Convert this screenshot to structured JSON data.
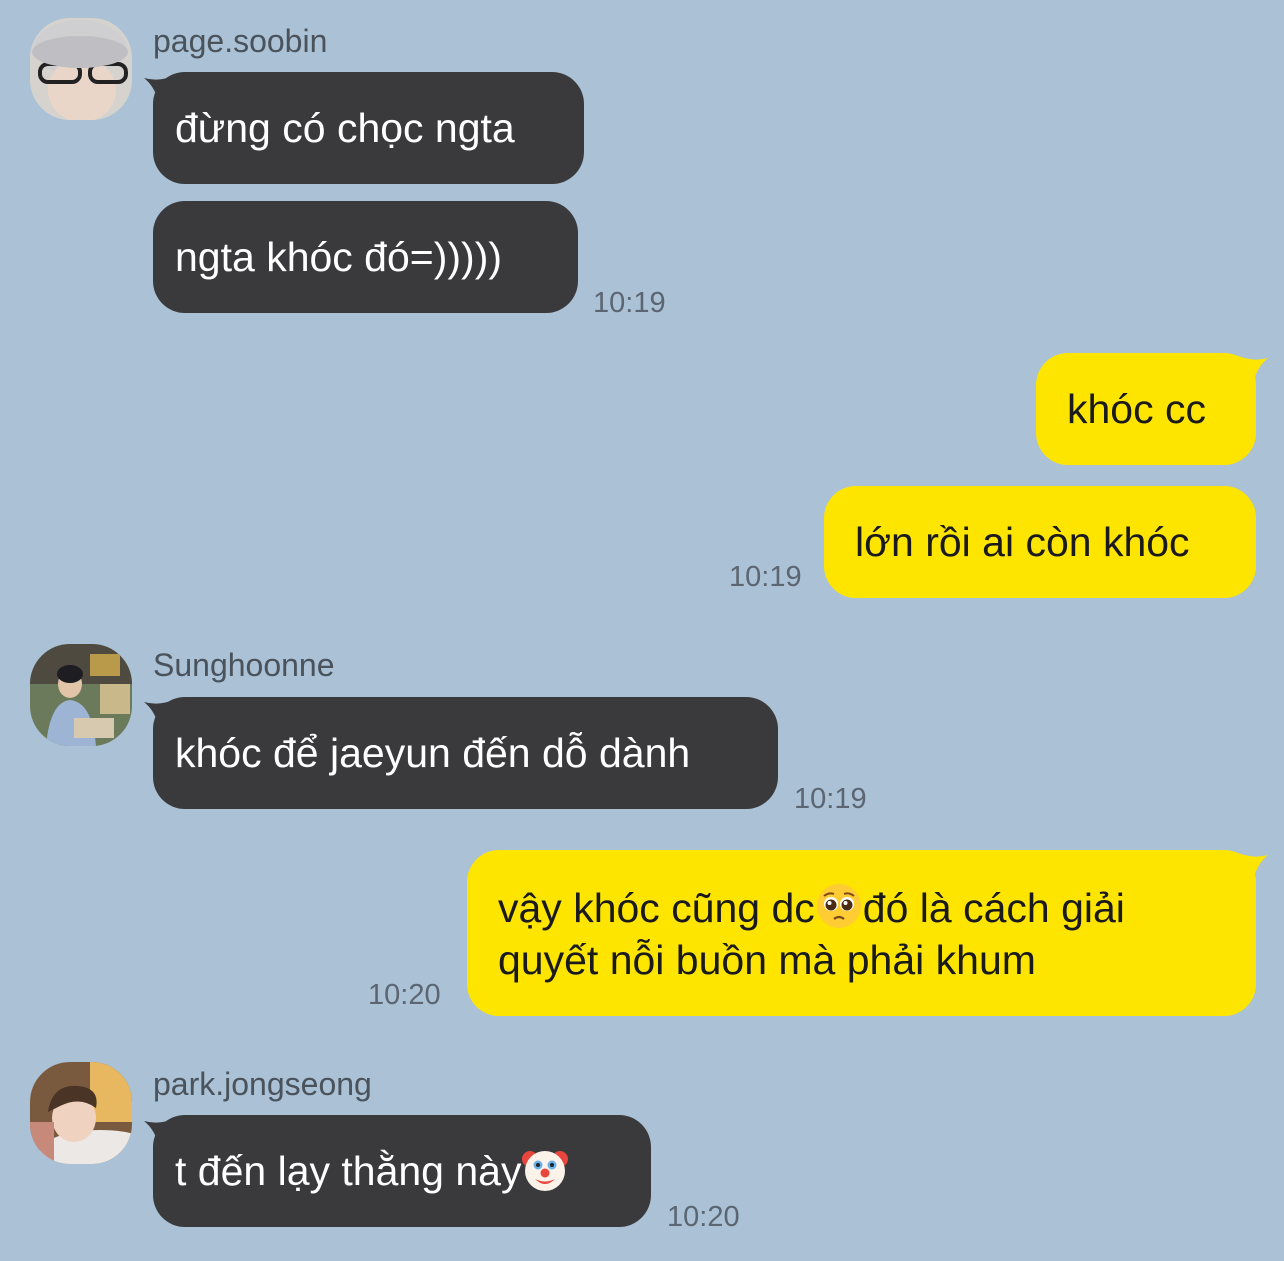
{
  "messages": [
    {
      "sender": "page.soobin",
      "bubbles": [
        "đừng có chọc ngta",
        "ngta khóc đó=)))))"
      ],
      "time": "10:19"
    },
    {
      "sender": "me",
      "bubbles": [
        "khóc cc",
        "lớn rồi ai còn khóc"
      ],
      "time": "10:19"
    },
    {
      "sender": "Sunghoonne",
      "bubbles": [
        "khóc để jaeyun đến dỗ dành"
      ],
      "time": "10:19"
    },
    {
      "sender": "me",
      "bubbles": [
        {
          "part1": "vậy khóc cũng dc",
          "emoji": "pleading-face-emoji",
          "part2": "đó là cách giải quyết nỗi buồn mà phải khum"
        }
      ],
      "time": "10:20"
    },
    {
      "sender": "park.jongseong",
      "bubbles": [
        {
          "text": "t đến lạy thằng này",
          "emoji": "clown-face-emoji"
        }
      ],
      "time": "10:20"
    }
  ],
  "colors": {
    "background": "#abc1d5",
    "incoming_bubble": "#3a3a3c",
    "outgoing_bubble": "#fee500",
    "timestamp": "#5b6672",
    "sender_name": "#4a535c"
  },
  "icons": {
    "avatars": [
      "avatar-soobin",
      "avatar-sunghoon",
      "avatar-jongseong"
    ]
  }
}
